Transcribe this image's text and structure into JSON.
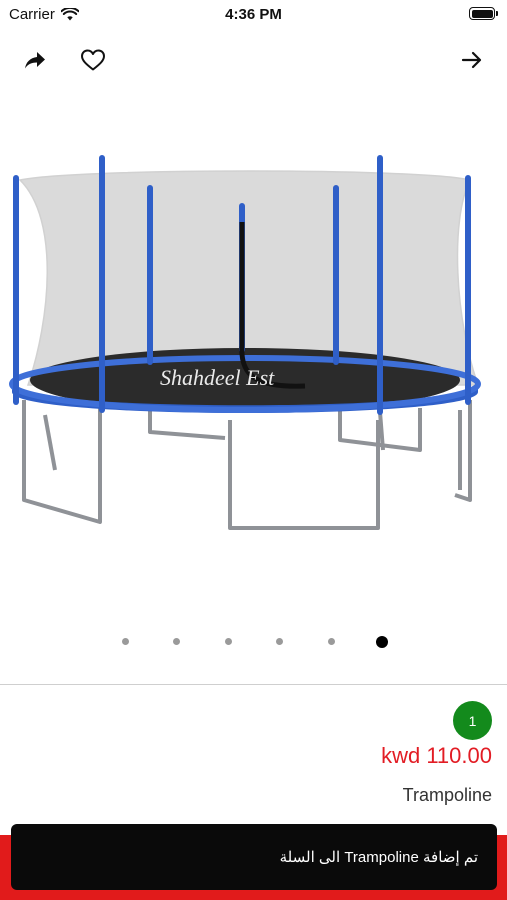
{
  "status_bar": {
    "carrier": "Carrier",
    "time": "4:36 PM"
  },
  "nav": {
    "share_icon": "share-arrow-icon",
    "favorite_icon": "heart-outline-icon",
    "forward_icon": "arrow-right-icon"
  },
  "gallery": {
    "image_subject": "trampoline",
    "watermark": "Shahdeel Est",
    "page_count": 6,
    "active_page": 6
  },
  "product": {
    "cart_count": "1",
    "price": "kwd 110.00",
    "name": "Trampoline"
  },
  "toast": {
    "message": "تم إضافة Trampoline  الى السلة"
  },
  "colors": {
    "price": "#e21c24",
    "badge": "#138a1c",
    "bottom_bar": "#e11b1b",
    "toast_bg": "#0a0a0a",
    "trampoline_frame": "#2f5fc8"
  }
}
